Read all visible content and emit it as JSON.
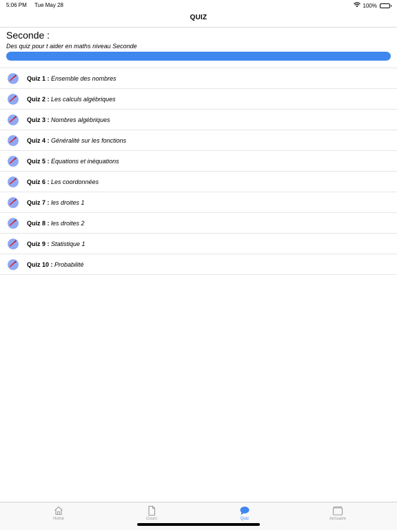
{
  "status_bar": {
    "time": "5:06 PM",
    "date": "Tue May 28",
    "battery": "100%",
    "wifi_icon": "wifi-icon",
    "battery_icon": "battery-icon"
  },
  "nav": {
    "title": "QUIZ"
  },
  "header": {
    "title": "Seconde :",
    "subtitle": "Des quiz pour t aider en maths niveau Seconde",
    "progress": 1.0,
    "accent_color": "#3f87ee"
  },
  "quizzes": [
    {
      "number": "Quiz 1 :",
      "topic": "Ensemble des nombres",
      "icon": "pencil-badge-icon"
    },
    {
      "number": "Quiz 2 :",
      "topic": "Les calculs algébriques",
      "icon": "pencil-badge-icon"
    },
    {
      "number": "Quiz 3 :",
      "topic": "Nombres algébriques",
      "icon": "pencil-badge-icon"
    },
    {
      "number": "Quiz 4 :",
      "topic": "Généralité sur les fonctions",
      "icon": "pencil-badge-icon"
    },
    {
      "number": "Quiz 5 :",
      "topic": "Equations et inéquations",
      "icon": "pencil-badge-icon"
    },
    {
      "number": "Quiz 6 :",
      "topic": "Les coordonnées",
      "icon": "pencil-badge-icon"
    },
    {
      "number": "Quiz 7 :",
      "topic": "les droites 1",
      "icon": "pencil-badge-icon"
    },
    {
      "number": "Quiz 8 :",
      "topic": "les droites 2",
      "icon": "pencil-badge-icon"
    },
    {
      "number": "Quiz 9 :",
      "topic": "Statistique 1",
      "icon": "pencil-badge-icon"
    },
    {
      "number": "Quiz 10 :",
      "topic": "Probabilité",
      "icon": "pencil-badge-icon"
    }
  ],
  "tabs": [
    {
      "label": "Home",
      "icon": "home-icon",
      "active": false
    },
    {
      "label": "Cours",
      "icon": "document-icon",
      "active": false
    },
    {
      "label": "Quiz",
      "icon": "chat-bubble-icon",
      "active": true
    },
    {
      "label": "Annuaire",
      "icon": "folder-icon",
      "active": false
    }
  ]
}
